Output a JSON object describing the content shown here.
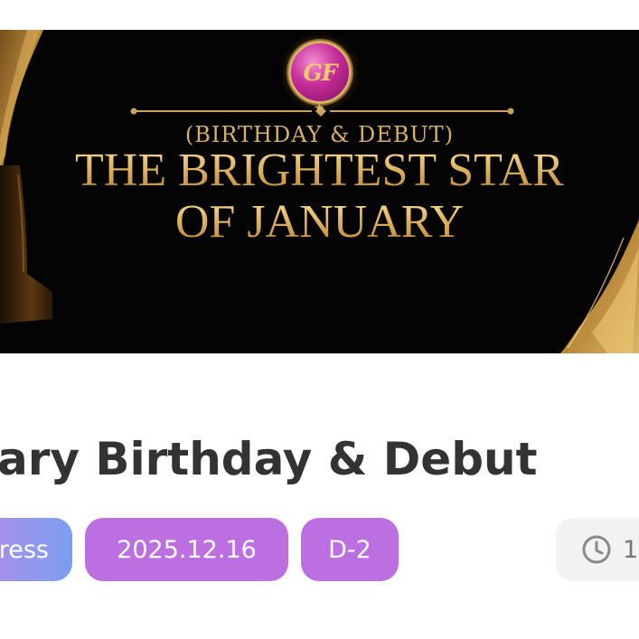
{
  "banner": {
    "logo_text": "GF",
    "subtitle": "(BIRTHDAY & DEBUT)",
    "title_line1": "THE BRIGHTEST STAR",
    "title_line2": "OF JANUARY"
  },
  "event": {
    "title": "ary Birthday & Debut"
  },
  "tags": {
    "status": "ress",
    "date": "2025.12.16",
    "dday": "D-2",
    "time_partial": "1",
    "time_icon": "clock-icon"
  },
  "colors": {
    "tag_purple": "#bb6fe0",
    "tag_gradient_start": "#b78be6",
    "tag_gradient_end": "#7a9ef0",
    "title_text": "#333333",
    "gold": "#d9ac57"
  }
}
